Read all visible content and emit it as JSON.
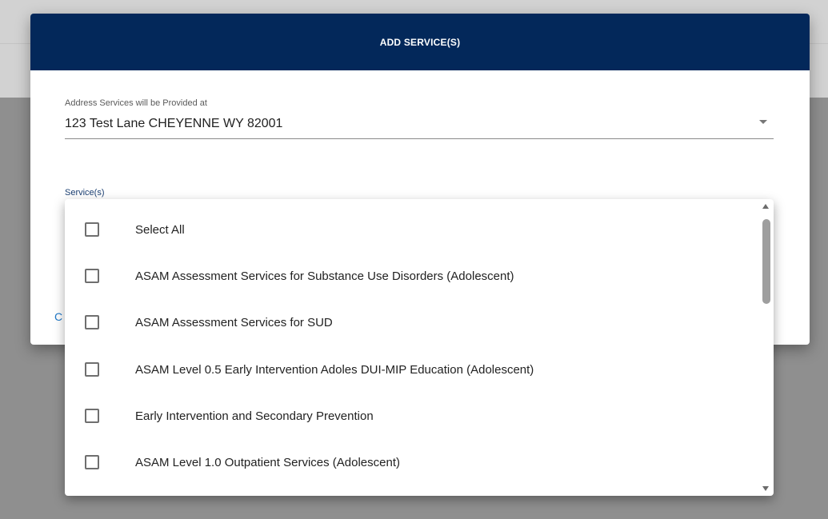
{
  "dialog": {
    "title": "ADD SERVICE(S)",
    "address_label": "Address Services will be Provided at",
    "address_value": "123 Test Lane CHEYENNE WY 82001",
    "services_label": "Service(s)",
    "cancel_partial": "C"
  },
  "dropdown": {
    "options": [
      {
        "label": "Select All",
        "checked": false
      },
      {
        "label": "ASAM Assessment Services for Substance Use Disorders (Adolescent)",
        "checked": false
      },
      {
        "label": "ASAM Assessment Services for SUD",
        "checked": false
      },
      {
        "label": "ASAM Level 0.5 Early Intervention Adoles DUI-MIP Education (Adolescent)",
        "checked": false
      },
      {
        "label": "Early Intervention and Secondary Prevention",
        "checked": false
      },
      {
        "label": "ASAM Level 1.0 Outpatient Services (Adolescent)",
        "checked": false
      }
    ]
  },
  "colors": {
    "header_bg": "#03285a",
    "link": "#1f78c8",
    "backdrop": "#8f8f8f"
  },
  "icons": {
    "address_dropdown": "chevron-down-icon",
    "scroll_up": "scroll-up-arrow-icon",
    "scroll_down": "scroll-down-arrow-icon"
  }
}
